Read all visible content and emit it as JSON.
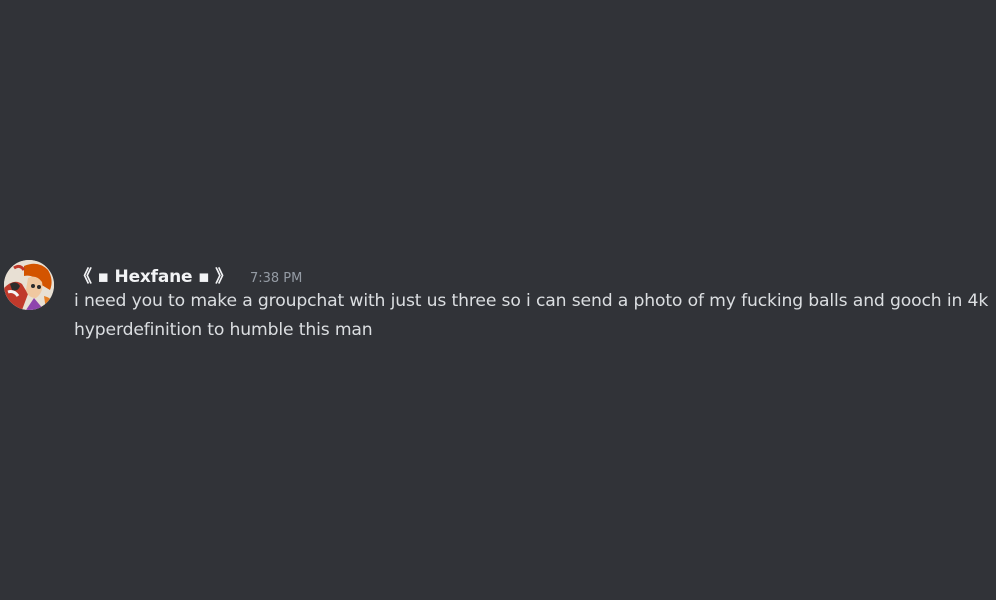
{
  "message": {
    "author": "《 ▪ Hexfane ▪ 》",
    "timestamp": "7:38 PM",
    "text": "i need you to make a groupchat with just us three so i can send a photo of my fucking balls and gooch in 4k hyperdefinition to humble this man"
  },
  "colors": {
    "background": "#313338",
    "username": "#f2f3f5",
    "timestamp": "#949ba4",
    "message_text": "#dbdee1"
  }
}
